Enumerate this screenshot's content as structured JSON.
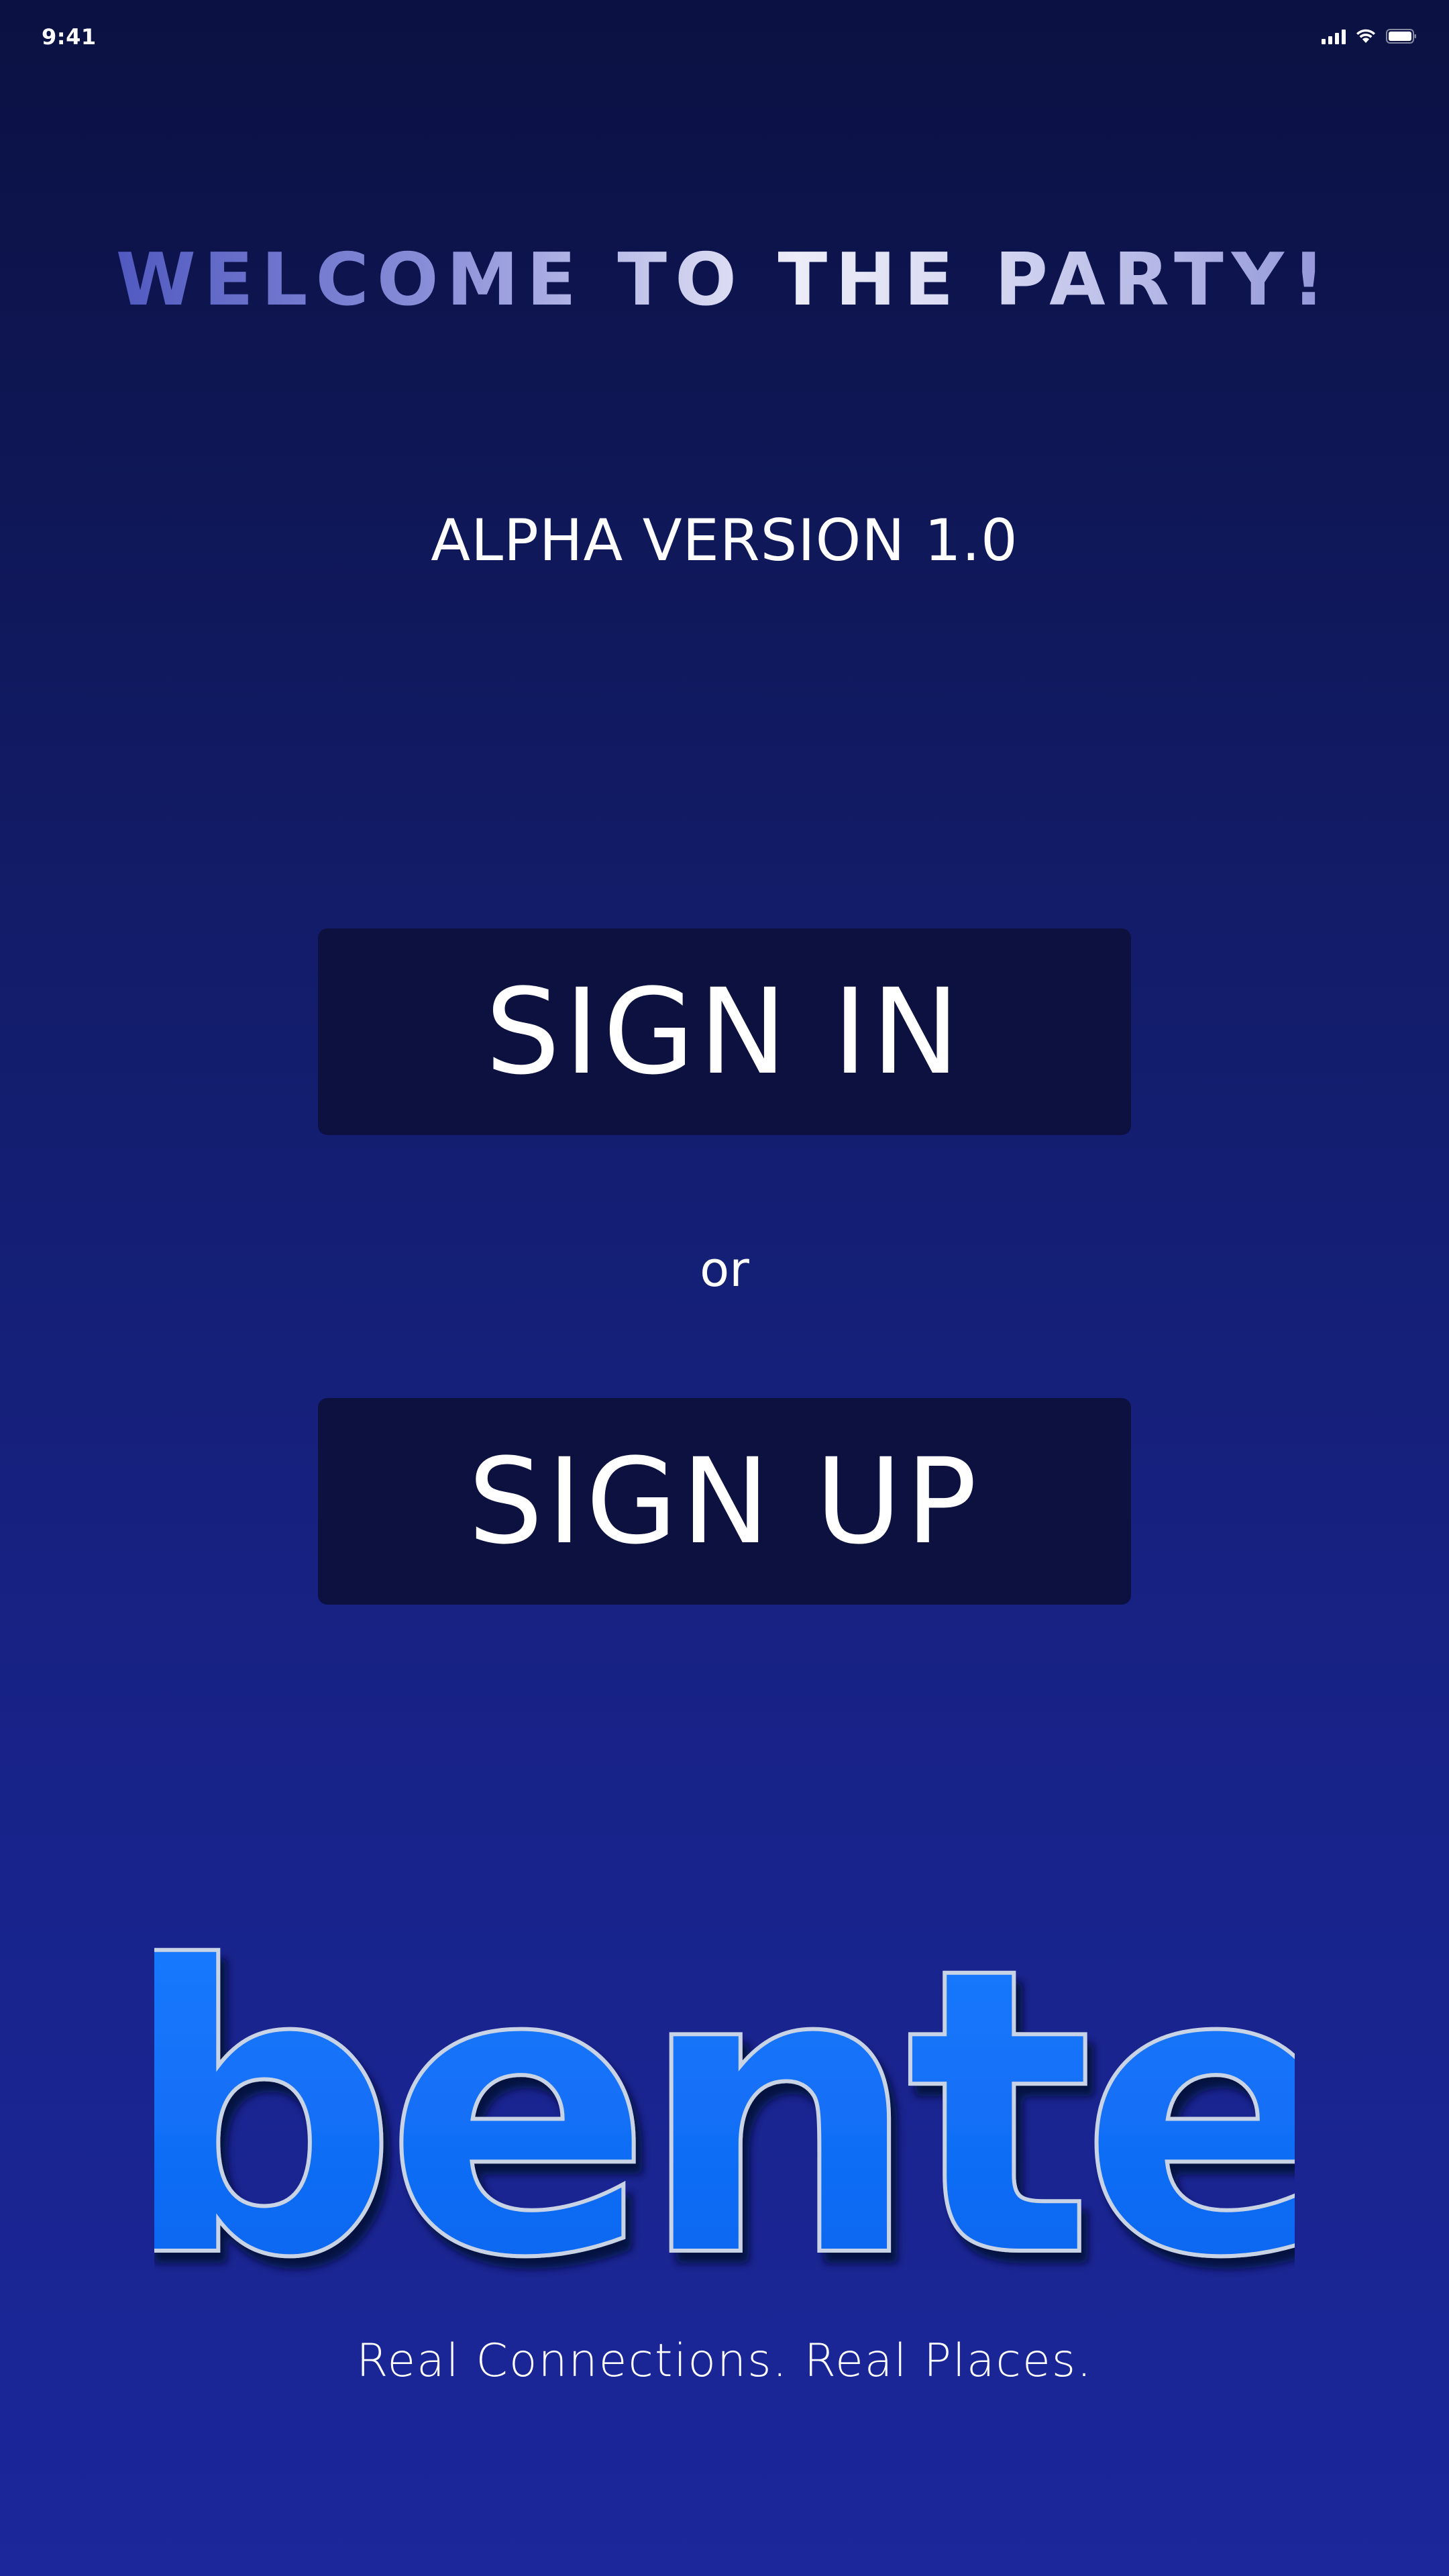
{
  "status_bar": {
    "time": "9:41",
    "icons": [
      "signal-icon",
      "wifi-icon",
      "battery-icon"
    ]
  },
  "welcome": {
    "title": "WELCOME TO THE PARTY!"
  },
  "version": {
    "label": "ALPHA VERSION 1.0"
  },
  "auth": {
    "sign_in_label": "SIGN IN",
    "or_label": "or",
    "sign_up_label": "SIGN UP"
  },
  "brand": {
    "logo_text": "bente",
    "tagline": "Real Connections. Real Places."
  },
  "colors": {
    "background_top": "#0b1142",
    "background_bottom": "#1b279a",
    "button_background": "#0c1140",
    "logo_blue": "#0a6ef5",
    "text": "#ffffff"
  }
}
